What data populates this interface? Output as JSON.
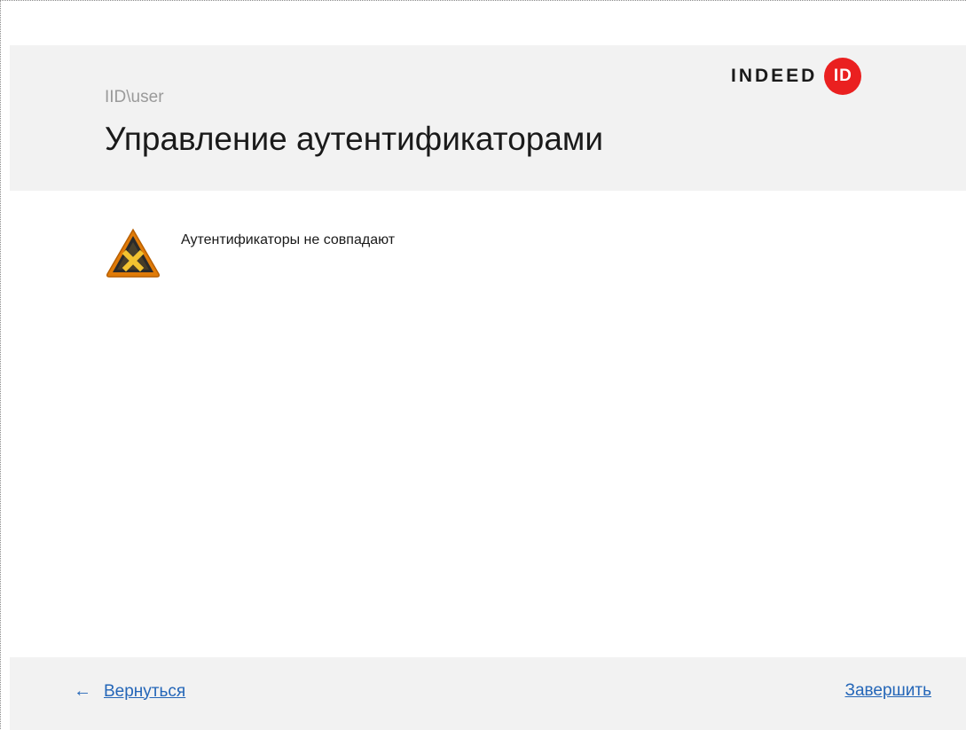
{
  "header": {
    "user": "IID\\user",
    "title": "Управление аутентификаторами",
    "logo_word": "INDEED",
    "logo_mark": "ID",
    "logo_color": "#ea2020"
  },
  "message": {
    "icon": "warning-icon",
    "text": "Аутентификаторы не совпадают"
  },
  "footer": {
    "back_icon": "arrow-left-icon",
    "back_label": "Вернуться",
    "finish_label": "Завершить",
    "link_color": "#2466b8"
  }
}
